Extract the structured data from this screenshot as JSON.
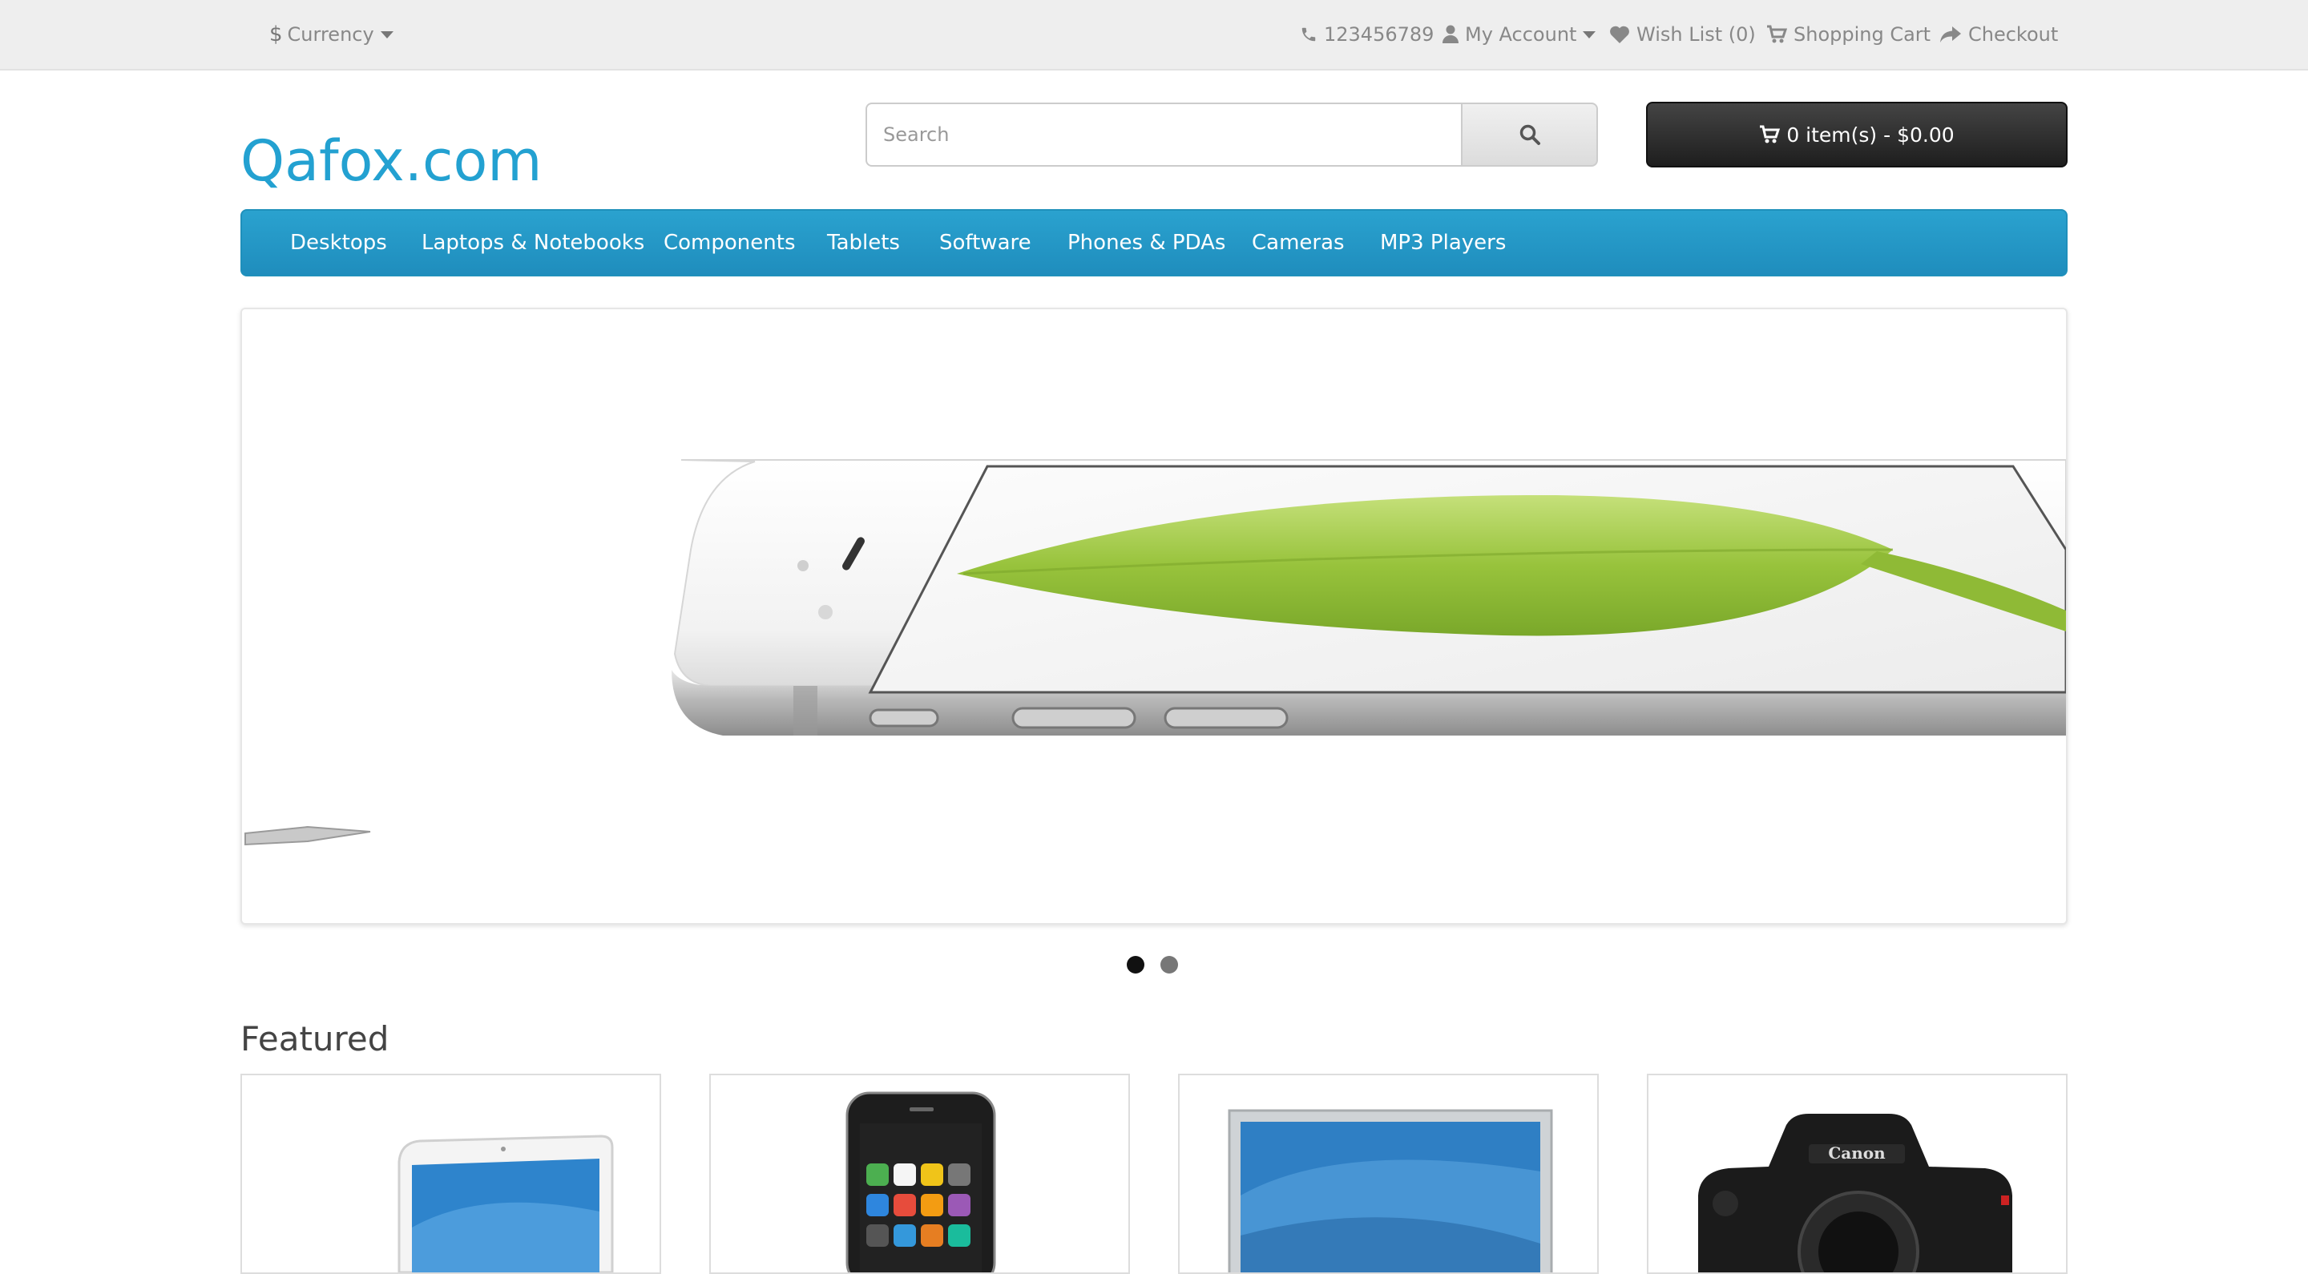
{
  "topbar": {
    "currency_label": "Currency",
    "phone": "123456789",
    "my_account": "My Account",
    "wish_list": "Wish List (0)",
    "shopping_cart": "Shopping Cart",
    "checkout": "Checkout"
  },
  "header": {
    "logo": "Qafox.com",
    "search_placeholder": "Search",
    "cart_summary": "0 item(s) - $0.00"
  },
  "menu": {
    "items": [
      "Desktops",
      "Laptops & Notebooks",
      "Components",
      "Tablets",
      "Software",
      "Phones & PDAs",
      "Cameras",
      "MP3 Players"
    ]
  },
  "slideshow": {
    "slides": 2,
    "active_slide": 1
  },
  "featured": {
    "title": "Featured",
    "products": [
      "macbook-thumbnail",
      "iphone-thumbnail",
      "apple-cinema-display-thumbnail",
      "canon-camera-thumbnail"
    ]
  },
  "colors": {
    "brand_blue": "#23a1d1",
    "menu_blue": "#229ac8",
    "cart_dark": "#303030",
    "topbar_bg": "#eeeeee"
  }
}
